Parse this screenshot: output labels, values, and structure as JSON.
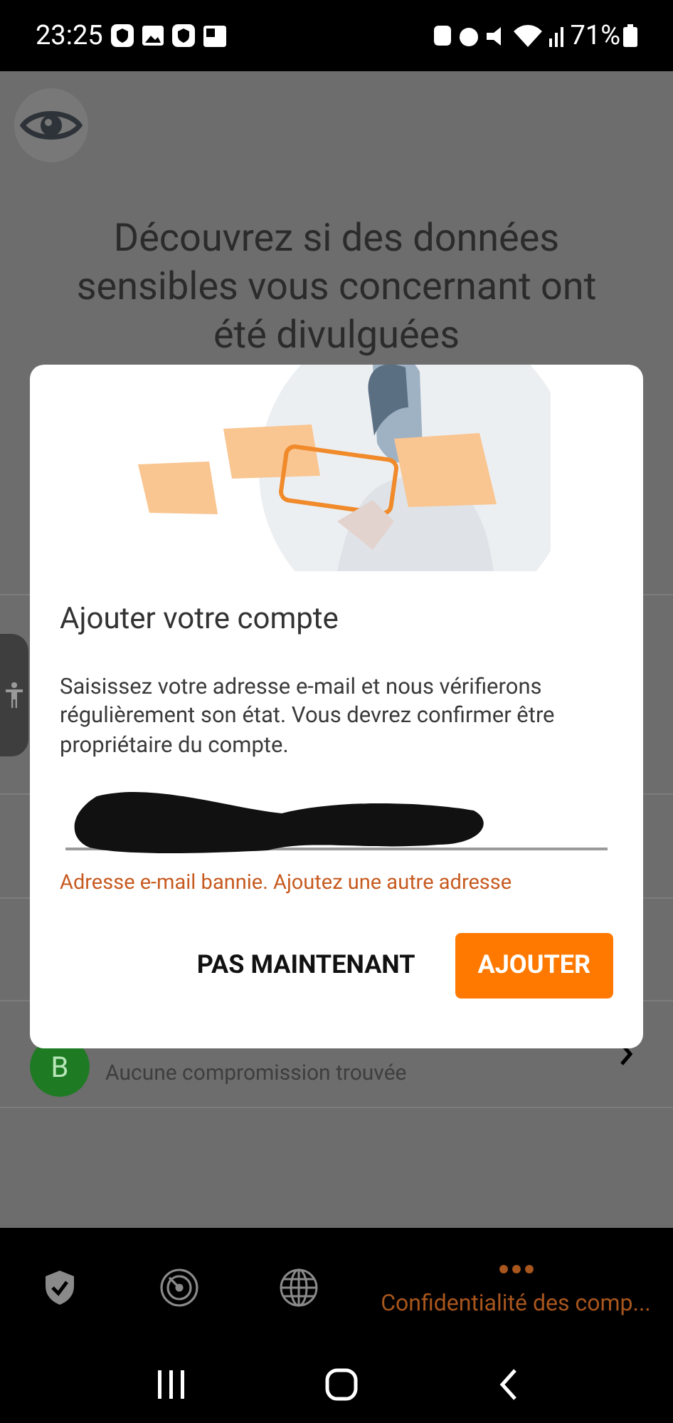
{
  "status_bar": {
    "time": "23:25",
    "battery": "71%"
  },
  "page": {
    "heading": "Découvrez si des données sensibles vous concernant ont été divulguées"
  },
  "accounts": [
    {
      "initial": "B",
      "color": "#1f7a24",
      "status": "Aucune compromission trouvée"
    }
  ],
  "dialog": {
    "title": "Ajouter votre compte",
    "body": "Saisissez votre adresse e-mail et nous vérifierons régulièrement son état. Vous devrez confirmer être propriétaire du compte.",
    "email_field": {
      "error": "Adresse e-mail bannie. Ajoutez une autre adresse"
    },
    "buttons": [
      {
        "label": "PAS MAINTENANT",
        "kind": "text"
      },
      {
        "label": "AJOUTER",
        "kind": "primary"
      }
    ]
  },
  "bottom_nav": [
    {
      "kind": "shield",
      "selected": false
    },
    {
      "kind": "radar",
      "selected": false
    },
    {
      "kind": "globe",
      "selected": false
    },
    {
      "kind": "more",
      "label": "Confidentialité des comp...",
      "selected": true
    }
  ]
}
